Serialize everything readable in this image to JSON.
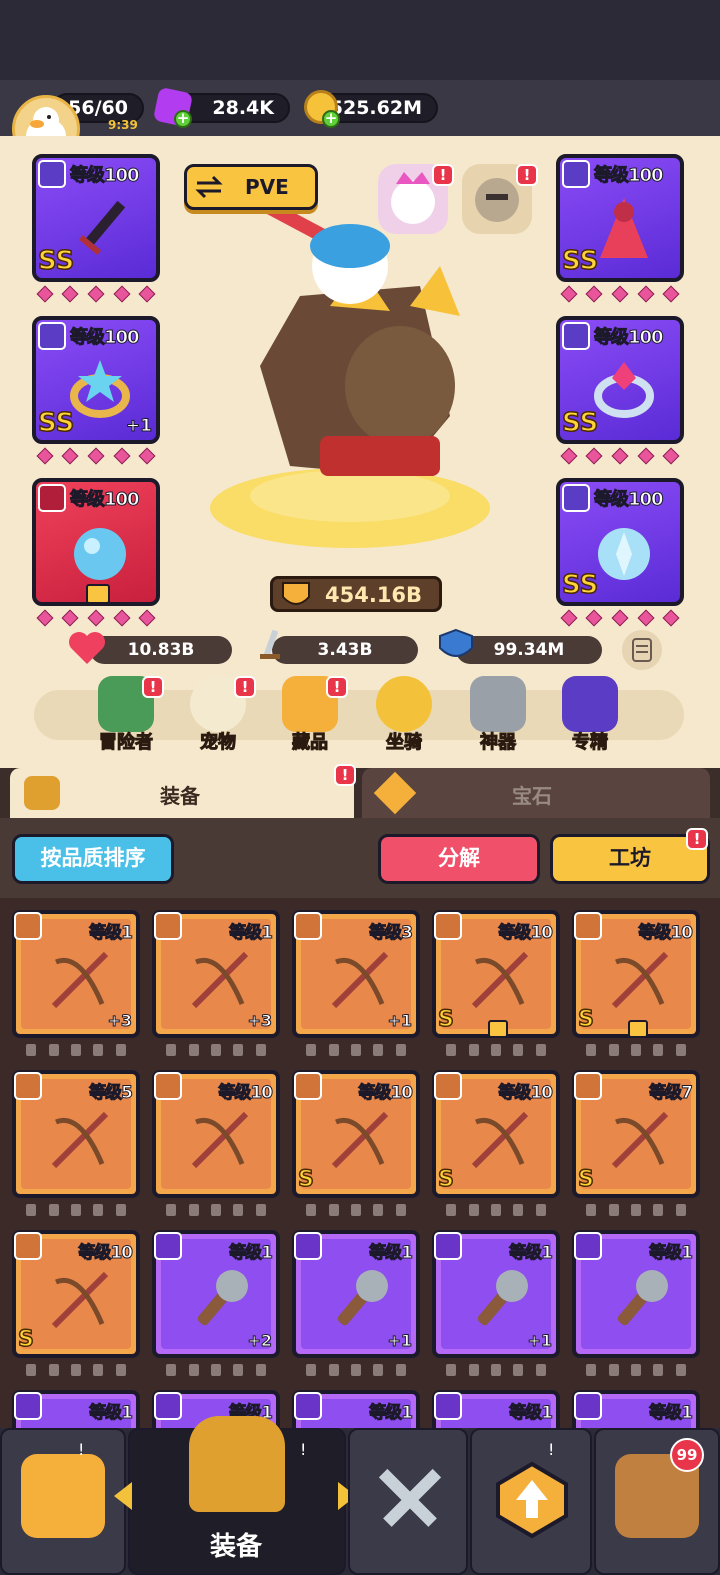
{
  "resources": {
    "stamina": "56/60",
    "stamina_timer": "9:39",
    "gems": "28.4K",
    "gold": "525.62M"
  },
  "hero": {
    "mode_label": "PVE",
    "power": "454.16B",
    "hp": "10.83B",
    "attack": "3.43B",
    "defense": "99.34M"
  },
  "equipped": [
    {
      "slot": "weapon",
      "level": "等级100",
      "grade": "SS",
      "plus": "",
      "locked": true,
      "color": "purple"
    },
    {
      "slot": "armor",
      "level": "等级100",
      "grade": "SS",
      "plus": "",
      "locked": false,
      "color": "purple"
    },
    {
      "slot": "ring",
      "level": "等级100",
      "grade": "SS",
      "plus": "+1",
      "locked": false,
      "color": "purple"
    },
    {
      "slot": "ring2",
      "level": "等级100",
      "grade": "SS",
      "plus": "",
      "locked": false,
      "color": "purple"
    },
    {
      "slot": "necklace",
      "level": "等级100",
      "grade": "",
      "plus": "",
      "locked": true,
      "color": "red"
    },
    {
      "slot": "necklace2",
      "level": "等级100",
      "grade": "SS",
      "plus": "",
      "locked": false,
      "color": "purple"
    }
  ],
  "menu": [
    "冒险者",
    "宠物",
    "藏品",
    "坐骑",
    "神器",
    "专精"
  ],
  "tabs": {
    "equip": "装备",
    "gem": "宝石"
  },
  "actions": {
    "sort": "按品质排序",
    "decompose": "分解",
    "workshop": "工坊"
  },
  "inventory": [
    {
      "level": "等级1",
      "grade": "",
      "plus": "+3",
      "color": "orange",
      "lock": false
    },
    {
      "level": "等级1",
      "grade": "",
      "plus": "+3",
      "color": "orange",
      "lock": false
    },
    {
      "level": "等级3",
      "grade": "",
      "plus": "+1",
      "color": "orange",
      "lock": false
    },
    {
      "level": "等级10",
      "grade": "S",
      "plus": "",
      "color": "orange",
      "lock": true
    },
    {
      "level": "等级10",
      "grade": "S",
      "plus": "",
      "color": "orange",
      "lock": true
    },
    {
      "level": "等级5",
      "grade": "",
      "plus": "",
      "color": "orange",
      "lock": false
    },
    {
      "level": "等级10",
      "grade": "",
      "plus": "",
      "color": "orange",
      "lock": false
    },
    {
      "level": "等级10",
      "grade": "S",
      "plus": "",
      "color": "orange",
      "lock": false
    },
    {
      "level": "等级10",
      "grade": "S",
      "plus": "",
      "color": "orange",
      "lock": false
    },
    {
      "level": "等级7",
      "grade": "S",
      "plus": "",
      "color": "orange",
      "lock": false
    },
    {
      "level": "等级10",
      "grade": "S",
      "plus": "",
      "color": "orange",
      "lock": false
    },
    {
      "level": "等级1",
      "grade": "",
      "plus": "+2",
      "color": "violet",
      "lock": false
    },
    {
      "level": "等级1",
      "grade": "",
      "plus": "+1",
      "color": "violet",
      "lock": false
    },
    {
      "level": "等级1",
      "grade": "",
      "plus": "+1",
      "color": "violet",
      "lock": false
    },
    {
      "level": "等级1",
      "grade": "",
      "plus": "",
      "color": "violet",
      "lock": false
    },
    {
      "level": "等级1",
      "grade": "",
      "plus": "",
      "color": "violet",
      "lock": false
    },
    {
      "level": "等级1",
      "grade": "",
      "plus": "",
      "color": "violet",
      "lock": false
    },
    {
      "level": "等级1",
      "grade": "",
      "plus": "",
      "color": "violet",
      "lock": false
    },
    {
      "level": "等级1",
      "grade": "",
      "plus": "",
      "color": "violet",
      "lock": false
    },
    {
      "level": "等级1",
      "grade": "",
      "plus": "",
      "color": "violet",
      "lock": false
    }
  ],
  "nav": {
    "active_label": "装备",
    "chest_count": "99",
    "alert": "!"
  }
}
